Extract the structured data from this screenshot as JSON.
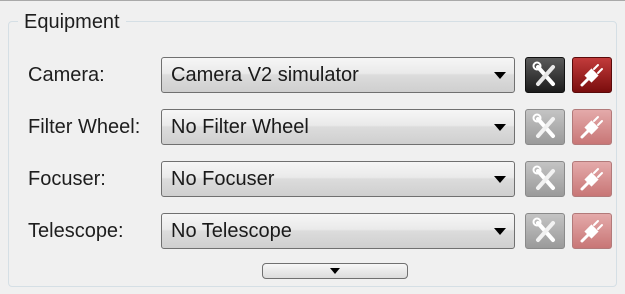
{
  "group": {
    "title": "Equipment"
  },
  "rows": [
    {
      "label": "Camera:",
      "selected": "Camera V2 simulator",
      "active": true
    },
    {
      "label": "Filter Wheel:",
      "selected": "No Filter Wheel",
      "active": false
    },
    {
      "label": "Focuser:",
      "selected": "No Focuser",
      "active": false
    },
    {
      "label": "Telescope:",
      "selected": "No Telescope",
      "active": false
    }
  ],
  "icons": {
    "setup": "wrench-screwdriver-icon",
    "connect": "plug-connect-icon",
    "dropdown": "dropdown-arrow-icon",
    "expand": "expand-down-arrow-icon"
  },
  "colors": {
    "setup_active": "#2a2a2a",
    "setup_inactive": "#a8a8a8",
    "connect_active": "#a01e1e",
    "connect_inactive": "#d89a9a"
  }
}
